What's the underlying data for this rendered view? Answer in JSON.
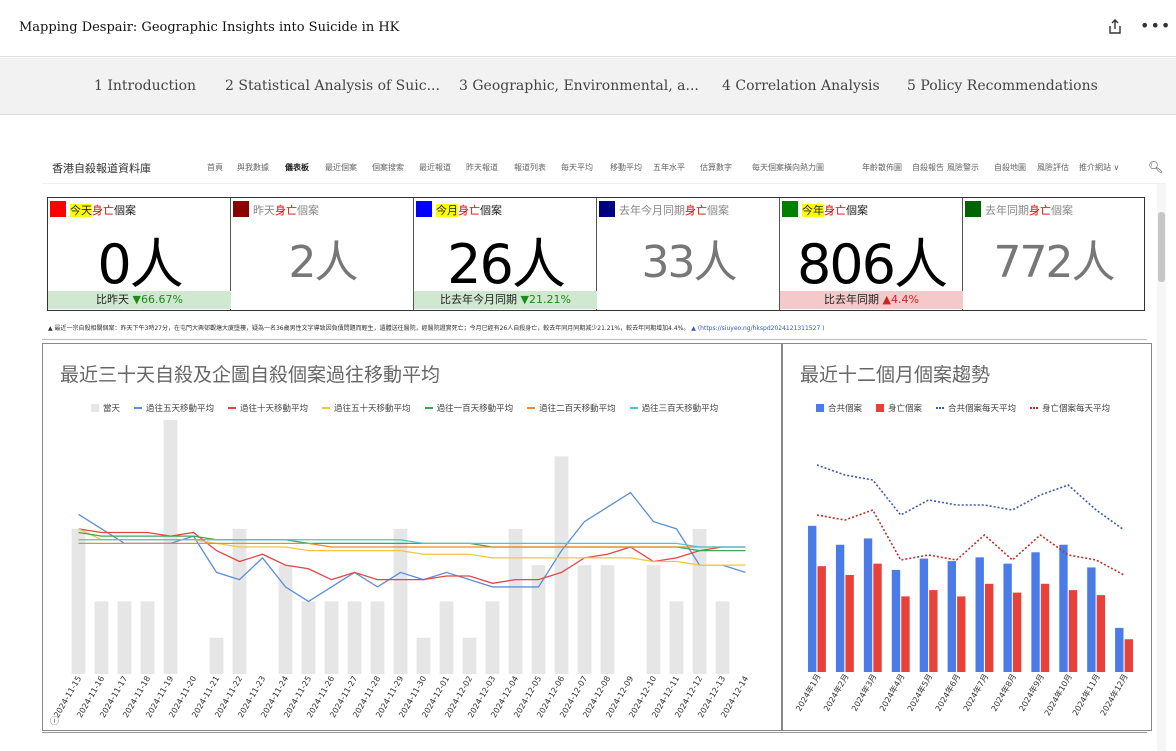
{
  "header": {
    "title": "Mapping Despair: Geographic Insights into Suicide in HK",
    "share_icon": "share-icon",
    "more_icon": "more-icon"
  },
  "tabs": [
    {
      "label": "1 Introduction"
    },
    {
      "label": "2 Statistical Analysis of Suic..."
    },
    {
      "label": "3 Geographic, Environmental, a..."
    },
    {
      "label": "4 Correlation Analysis"
    },
    {
      "label": "5 Policy Recommendations"
    }
  ],
  "dashboard": {
    "brand": "香港自殺報道資料庫",
    "nav": [
      "首頁",
      "與我數據",
      "儀表板",
      "最近個案",
      "個案搜索",
      "最近報道",
      "昨天報道",
      "報道列表",
      "每天平均",
      "移動平均",
      "五年水平",
      "估算數字",
      "每天個案橫向熱力圖",
      "年齡散佈圖",
      "自殺報告",
      "風險警示",
      "自殺地圖",
      "風險評估",
      "推介網站 ∨"
    ],
    "active_nav": 2,
    "cards": [
      {
        "label_a": "今天",
        "label_b": "身亡",
        "label_c": "個案",
        "value": "0人",
        "compare": "比昨天 ▼66.67%",
        "color": "#ff0000",
        "highlight": true,
        "cmp_type": "green"
      },
      {
        "label_a": "昨天",
        "label_b": "身亡",
        "label_c": "個案",
        "value": "2人",
        "compare": "",
        "color": "#8b0000",
        "highlight": false,
        "cmp_type": ""
      },
      {
        "label_a": "今月",
        "label_b": "身亡",
        "label_c": "個案",
        "value": "26人",
        "compare": "比去年今月同期 ▼21.21%",
        "color": "#0000ff",
        "highlight": true,
        "cmp_type": "green"
      },
      {
        "label_a": "去年今月同期",
        "label_b": "身亡",
        "label_c": "個案",
        "value": "33人",
        "compare": "",
        "color": "#000080",
        "highlight": false,
        "cmp_type": ""
      },
      {
        "label_a": "今年",
        "label_b": "身亡",
        "label_c": "個案",
        "value": "806人",
        "compare": "比去年同期 ▲4.4%",
        "color": "#008000",
        "highlight": true,
        "cmp_type": "red"
      },
      {
        "label_a": "去年同期",
        "label_b": "身亡",
        "label_c": "個案",
        "value": "772人",
        "compare": "",
        "color": "#006400",
        "highlight": false,
        "cmp_type": ""
      }
    ],
    "ticker": "▲ 最近一宗自殺相關個案：昨天下午3時27分，在屯門大興邨觀塘大廈墮樓，疑為一名36歲男性文字導致因負債問題而輕生，遺體送往醫院，經醫院證實死亡；今月已經有26人自殺身亡，較去年同月同期減少21.21%，較去年同期增加4.4%。",
    "ticker_link": "▲ (https://siuyeo.ng/hkspd2024121311527 )"
  },
  "chart_data": [
    {
      "type": "bar",
      "title": "最近三十天自殺及企圖自殺個案過往移動平均",
      "categories": [
        "2024-11-15",
        "2024-11-16",
        "2024-11-17",
        "2024-11-18",
        "2024-11-19",
        "2024-11-20",
        "2024-11-21",
        "2024-11-22",
        "2024-11-23",
        "2024-11-24",
        "2024-11-25",
        "2024-11-26",
        "2024-11-27",
        "2024-11-28",
        "2024-11-29",
        "2024-11-30",
        "2024-12-01",
        "2024-12-02",
        "2024-12-03",
        "2024-12-04",
        "2024-12-05",
        "2024-12-06",
        "2024-12-07",
        "2024-12-08",
        "2024-12-09",
        "2024-12-10",
        "2024-12-11",
        "2024-12-12",
        "2024-12-13",
        "2024-12-14"
      ],
      "ylim": [
        0,
        7
      ],
      "series": [
        {
          "name": "當天",
          "kind": "bar",
          "color": "#e6e6e6",
          "values": [
            4,
            2,
            2,
            2,
            7,
            0,
            1,
            4,
            0,
            3,
            2,
            2,
            2,
            2,
            4,
            1,
            2,
            1,
            2,
            4,
            3,
            6,
            3,
            3,
            0,
            3,
            2,
            4,
            2,
            0
          ]
        },
        {
          "name": "過往五天移動平均",
          "kind": "line",
          "color": "#5b8fd9",
          "values": [
            4.4,
            4.0,
            3.6,
            3.6,
            3.6,
            3.8,
            2.8,
            2.6,
            3.2,
            2.4,
            2.0,
            2.4,
            2.8,
            2.4,
            2.8,
            2.6,
            2.8,
            2.6,
            2.4,
            2.4,
            2.4,
            3.4,
            4.2,
            4.6,
            5.0,
            4.2,
            4.0,
            3.0,
            3.0,
            2.8
          ]
        },
        {
          "name": "過往十天移動平均",
          "kind": "line",
          "color": "#e54545",
          "values": [
            4.0,
            3.9,
            3.9,
            3.9,
            3.8,
            3.9,
            3.4,
            3.1,
            3.3,
            3.0,
            2.9,
            2.6,
            2.8,
            2.6,
            2.6,
            2.6,
            2.7,
            2.7,
            2.5,
            2.6,
            2.6,
            2.8,
            3.2,
            3.3,
            3.5,
            3.1,
            3.2,
            3.4,
            3.5,
            3.5
          ]
        },
        {
          "name": "過往五十天移動平均",
          "kind": "line",
          "color": "#f4c542",
          "values": [
            4.0,
            3.7,
            3.7,
            3.7,
            3.7,
            3.7,
            3.6,
            3.5,
            3.5,
            3.5,
            3.4,
            3.4,
            3.4,
            3.4,
            3.4,
            3.3,
            3.3,
            3.3,
            3.2,
            3.2,
            3.2,
            3.2,
            3.2,
            3.2,
            3.2,
            3.1,
            3.1,
            3.0,
            3.0,
            3.0
          ]
        },
        {
          "name": "過往一百天移動平均",
          "kind": "line",
          "color": "#3aa757",
          "values": [
            3.9,
            3.8,
            3.8,
            3.8,
            3.8,
            3.8,
            3.7,
            3.7,
            3.7,
            3.7,
            3.6,
            3.6,
            3.6,
            3.6,
            3.6,
            3.6,
            3.6,
            3.6,
            3.5,
            3.5,
            3.5,
            3.5,
            3.5,
            3.5,
            3.5,
            3.5,
            3.5,
            3.4,
            3.4,
            3.4
          ]
        },
        {
          "name": "過往二百天移動平均",
          "kind": "line",
          "color": "#f08a2b",
          "values": [
            3.6,
            3.6,
            3.6,
            3.6,
            3.6,
            3.6,
            3.6,
            3.6,
            3.6,
            3.6,
            3.6,
            3.5,
            3.5,
            3.5,
            3.5,
            3.5,
            3.5,
            3.5,
            3.5,
            3.5,
            3.5,
            3.5,
            3.5,
            3.5,
            3.5,
            3.5,
            3.5,
            3.5,
            3.5,
            3.5
          ]
        },
        {
          "name": "過往三百天移動平均",
          "kind": "line",
          "color": "#4dc3d9",
          "values": [
            3.7,
            3.7,
            3.7,
            3.7,
            3.7,
            3.7,
            3.7,
            3.7,
            3.7,
            3.7,
            3.7,
            3.7,
            3.7,
            3.7,
            3.7,
            3.6,
            3.6,
            3.6,
            3.6,
            3.6,
            3.6,
            3.6,
            3.6,
            3.6,
            3.6,
            3.6,
            3.6,
            3.5,
            3.5,
            3.5
          ]
        }
      ]
    },
    {
      "type": "bar",
      "title": "最近十二個月個案趨勢",
      "categories": [
        "2024年1月",
        "2024年2月",
        "2024年3月",
        "2024年4月",
        "2024年5月",
        "2024年6月",
        "2024年7月",
        "2024年8月",
        "2024年9月",
        "2024年10月",
        "2024年11月",
        "2024年12月"
      ],
      "ylim": [
        0,
        200
      ],
      "series": [
        {
          "name": "合共個案",
          "kind": "bar",
          "color": "#4a7be8",
          "values": [
            116,
            101,
            106,
            81,
            90,
            88,
            91,
            86,
            95,
            101,
            83,
            35
          ]
        },
        {
          "name": "身亡個案",
          "kind": "bar",
          "color": "#e8413a",
          "values": [
            84,
            77,
            86,
            60,
            65,
            60,
            70,
            63,
            70,
            65,
            61,
            26
          ]
        },
        {
          "name": "合共個案每天平均",
          "kind": "dotted",
          "color": "#3b5bb5",
          "values": [
            3.7,
            3.5,
            3.4,
            2.7,
            3.0,
            2.9,
            2.9,
            2.8,
            3.1,
            3.3,
            2.8,
            2.4
          ]
        },
        {
          "name": "身亡個案每天平均",
          "kind": "dotted",
          "color": "#c0302a",
          "values": [
            2.7,
            2.6,
            2.8,
            1.8,
            1.9,
            1.8,
            2.3,
            1.8,
            2.3,
            1.9,
            1.8,
            1.5
          ]
        }
      ]
    }
  ]
}
